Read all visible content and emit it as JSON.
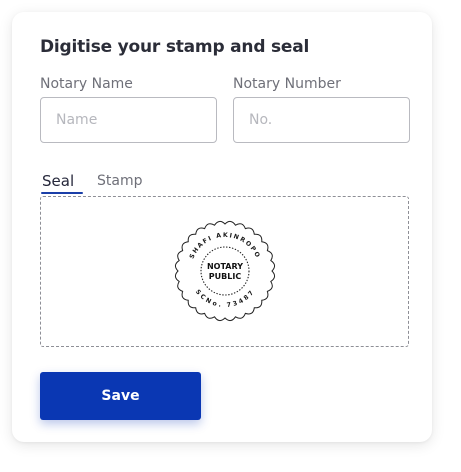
{
  "form": {
    "title": "Digitise your stamp and seal",
    "notary_name": {
      "label": "Notary Name",
      "placeholder": "Name",
      "value": ""
    },
    "notary_number": {
      "label": "Notary Number",
      "placeholder": "No.",
      "value": ""
    }
  },
  "tabs": [
    {
      "label": "Seal",
      "active": true
    },
    {
      "label": "Stamp",
      "active": false
    }
  ],
  "seal": {
    "top_text": "SHAFI AKINROPO",
    "bottom_text": "SCNo. 73487",
    "center_line1": "NOTARY",
    "center_line2": "PUBLIC"
  },
  "save_button": {
    "label": "Save"
  },
  "colors": {
    "accent": "#0a37b3",
    "tab_underline": "#1b3fa8",
    "title_text": "#2b2d38",
    "label_text": "#6f7079"
  }
}
